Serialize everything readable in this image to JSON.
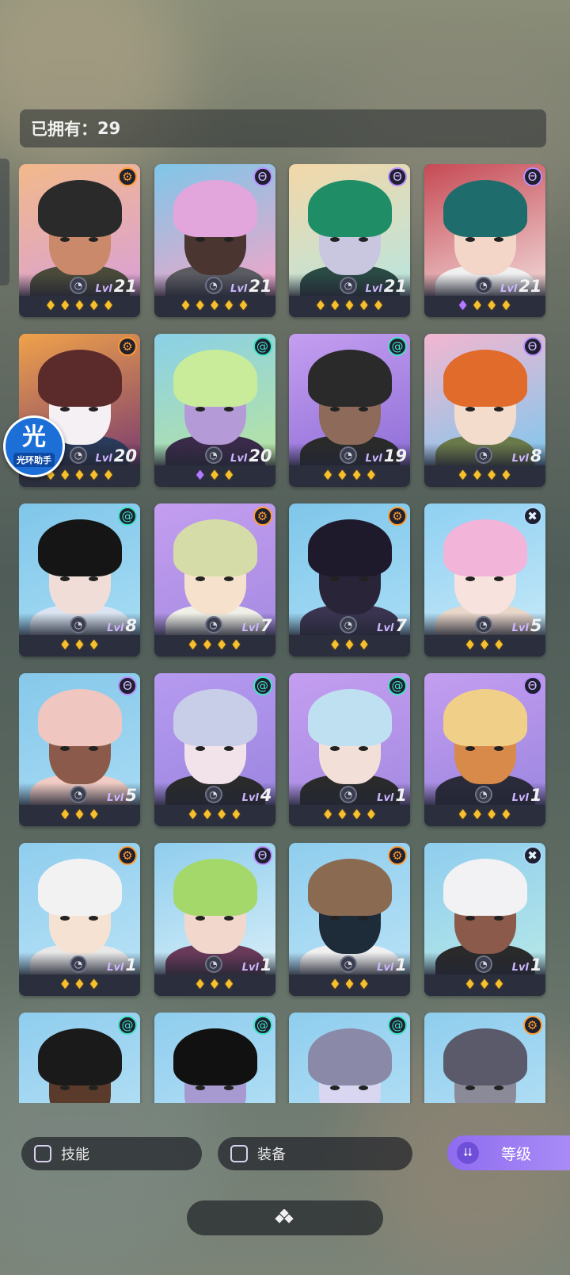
{
  "header": {
    "owned_label": "已拥有：",
    "owned_count": "29"
  },
  "floating_badge": {
    "glyph": "光",
    "label": "光环助手"
  },
  "colors": {
    "star_gold": "#f6c02e",
    "star_purple": "#b27cff",
    "accent_purple": "#9a7af2",
    "emblem_orange": "#ff9b2e",
    "emblem_purple": "#b98cff",
    "emblem_teal": "#3fe3c4"
  },
  "level_prefix": "Lvl",
  "heroes": [
    {
      "level": "21",
      "emblem": "orange",
      "emblem_icon": "sun-gear-icon",
      "stars": [
        "gold",
        "gold",
        "gold",
        "gold",
        "gold"
      ],
      "bg": "#f2b98a",
      "bg2": "#d9a0d8",
      "skin": "#c9896a",
      "hair": "#2a2a2a",
      "body": "#4a4a3a"
    },
    {
      "level": "21",
      "emblem": "purple",
      "emblem_icon": "arcane-icon",
      "stars": [
        "gold",
        "gold",
        "gold",
        "gold",
        "gold"
      ],
      "bg": "#7fc6e8",
      "bg2": "#f4a5c8",
      "skin": "#4a3530",
      "hair": "#e3a6dc",
      "body": "#5b5b62"
    },
    {
      "level": "21",
      "emblem": "purple",
      "emblem_icon": "arcane-icon",
      "stars": [
        "gold",
        "gold",
        "gold",
        "gold",
        "gold"
      ],
      "bg": "#f3d7a8",
      "bg2": "#b8e6e0",
      "skin": "#c9c7e0",
      "hair": "#1f8d66",
      "body": "#2a4a44"
    },
    {
      "level": "21",
      "emblem": "purple",
      "emblem_icon": "arcane-icon",
      "stars": [
        "purple",
        "gold",
        "gold",
        "gold"
      ],
      "bg": "#c64a55",
      "bg2": "#f2dada",
      "skin": "#f3d6c8",
      "hair": "#1f6c6c",
      "body": "#f0f0f0"
    },
    {
      "level": "20",
      "emblem": "orange",
      "emblem_icon": "sun-gear-icon",
      "stars": [
        "gold",
        "gold",
        "gold",
        "gold",
        "gold"
      ],
      "bg": "#f0a24a",
      "bg2": "#7b3d6e",
      "skin": "#f4f0f4",
      "hair": "#5b2a2a",
      "body": "#2a3a5a"
    },
    {
      "level": "20",
      "emblem": "teal",
      "emblem_icon": "swirl-icon",
      "stars": [
        "purple",
        "gold",
        "gold"
      ],
      "bg": "#8ad0e8",
      "bg2": "#b8e4a0",
      "skin": "#b59ad8",
      "hair": "#c9ec9a",
      "body": "#3a2a4a"
    },
    {
      "level": "19",
      "emblem": "teal",
      "emblem_icon": "swirl-icon",
      "stars": [
        "gold",
        "gold",
        "gold",
        "gold"
      ],
      "bg": "#c49ef0",
      "bg2": "#8f6fd8",
      "skin": "#8d6a5a",
      "hair": "#2a2a2a",
      "body": "#2a2a2a"
    },
    {
      "level": "8",
      "emblem": "purple",
      "emblem_icon": "arcane-icon",
      "stars": [
        "gold",
        "gold",
        "gold",
        "gold"
      ],
      "bg": "#f3b6d0",
      "bg2": "#7fc8ee",
      "skin": "#f3dccb",
      "hair": "#e06b2a",
      "body": "#6b7a4a"
    },
    {
      "level": "8",
      "emblem": "teal",
      "emblem_icon": "swirl-icon",
      "stars": [
        "gold",
        "gold",
        "gold"
      ],
      "bg": "#7fc6ea",
      "bg2": "#a7dcf4",
      "skin": "#f0ddd8",
      "hair": "#151515",
      "body": "#d9e4f0"
    },
    {
      "level": "7",
      "emblem": "orange",
      "emblem_icon": "sun-gear-icon",
      "stars": [
        "gold",
        "gold",
        "gold",
        "gold"
      ],
      "bg": "#c49ef0",
      "bg2": "#a58be2",
      "skin": "#f6e2cc",
      "hair": "#d6dca8",
      "body": "#f0f0e8"
    },
    {
      "level": "7",
      "emblem": "orange",
      "emblem_icon": "sun-gear-icon",
      "stars": [
        "gold",
        "gold",
        "gold"
      ],
      "bg": "#7fc6ea",
      "bg2": "#a8ddf6",
      "skin": "#2a2438",
      "hair": "#1e1a2c",
      "body": "#3a3450"
    },
    {
      "level": "5",
      "emblem": "blue",
      "emblem_icon": "cross-icon",
      "stars": [
        "gold",
        "gold",
        "gold"
      ],
      "bg": "#8fd0f2",
      "bg2": "#c4e8f8",
      "skin": "#f8e2de",
      "hair": "#f2b4d8",
      "body": "#e8d6c8"
    },
    {
      "level": "5",
      "emblem": "purple",
      "emblem_icon": "arcane-icon",
      "stars": [
        "gold",
        "gold",
        "gold"
      ],
      "bg": "#86c8ea",
      "bg2": "#a6daf4",
      "skin": "#8c5a4a",
      "hair": "#f0c6c0",
      "body": "#f0ccc4"
    },
    {
      "level": "4",
      "emblem": "teal",
      "emblem_icon": "swirl-icon",
      "stars": [
        "gold",
        "gold",
        "gold",
        "gold"
      ],
      "bg": "#b69af0",
      "bg2": "#9c86e0",
      "skin": "#f2e2ea",
      "hair": "#c8cee8",
      "body": "#2a2a2a"
    },
    {
      "level": "1",
      "emblem": "teal",
      "emblem_icon": "swirl-icon",
      "stars": [
        "gold",
        "gold",
        "gold",
        "gold"
      ],
      "bg": "#c49ef0",
      "bg2": "#a58be2",
      "skin": "#f2e0d8",
      "hair": "#bfe0f0",
      "body": "#2a2a2a"
    },
    {
      "level": "1",
      "emblem": "purple",
      "emblem_icon": "arcane-icon",
      "stars": [
        "gold",
        "gold",
        "gold",
        "gold"
      ],
      "bg": "#c49ef0",
      "bg2": "#9c86e0",
      "skin": "#d88a4a",
      "hair": "#f0d088",
      "body": "#2a2a3a"
    },
    {
      "level": "1",
      "emblem": "orange",
      "emblem_icon": "sun-gear-icon",
      "stars": [
        "gold",
        "gold",
        "gold"
      ],
      "bg": "#8fcdee",
      "bg2": "#b8e2f6",
      "skin": "#f6e2d2",
      "hair": "#f2f2f2",
      "body": "#e8e8e8"
    },
    {
      "level": "1",
      "emblem": "purple",
      "emblem_icon": "arcane-icon",
      "stars": [
        "gold",
        "gold",
        "gold"
      ],
      "bg": "#8fcdee",
      "bg2": "#d6eef8",
      "skin": "#f2d8cc",
      "hair": "#a4d86a",
      "body": "#6a3a5a"
    },
    {
      "level": "1",
      "emblem": "orange",
      "emblem_icon": "sun-gear-icon",
      "stars": [
        "gold",
        "gold",
        "gold"
      ],
      "bg": "#8fcdee",
      "bg2": "#b8e2f6",
      "skin": "#1e2c3a",
      "hair": "#8a6a50",
      "body": "#f0f0f0"
    },
    {
      "level": "1",
      "emblem": "blue",
      "emblem_icon": "cross-icon",
      "stars": [
        "gold",
        "gold",
        "gold"
      ],
      "bg": "#8fcdee",
      "bg2": "#b6e8e8",
      "skin": "#8c5a4a",
      "hair": "#f2f2f4",
      "body": "#2a2a2a"
    },
    {
      "level": "",
      "emblem": "teal",
      "emblem_icon": "swirl-icon",
      "stars": [],
      "bg": "#8fcdee",
      "bg2": "#b8e2f6",
      "skin": "#5a3a2a",
      "hair": "#1a1a1a",
      "body": "#2a2a2a"
    },
    {
      "level": "",
      "emblem": "teal",
      "emblem_icon": "swirl-icon",
      "stars": [],
      "bg": "#8fcdee",
      "bg2": "#b8e2f6",
      "skin": "#a69ad0",
      "hair": "#111111",
      "body": "#2a2a2a"
    },
    {
      "level": "",
      "emblem": "teal",
      "emblem_icon": "swirl-icon",
      "stars": [],
      "bg": "#8fcdee",
      "bg2": "#b8e2f6",
      "skin": "#d8d6f0",
      "hair": "#8a8aa8",
      "body": "#2a2a2a"
    },
    {
      "level": "",
      "emblem": "orange",
      "emblem_icon": "sun-gear-icon",
      "stars": [],
      "bg": "#8fcdee",
      "bg2": "#b8e2f6",
      "skin": "#8a8a98",
      "hair": "#5a5a6a",
      "body": "#2a2a2a"
    }
  ],
  "filters": {
    "skills_label": "技能",
    "equipment_label": "装备",
    "sort_label": "等级",
    "sort_icon": "chevrons-down-icon"
  },
  "bottom_bar": {
    "icon": "diamond-cluster-icon"
  }
}
